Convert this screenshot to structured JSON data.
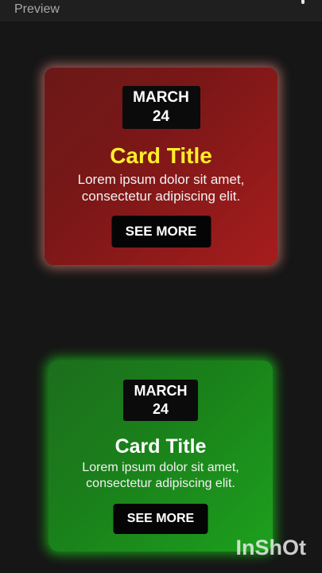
{
  "header": {
    "title": "Preview"
  },
  "cards": [
    {
      "date_month": "MARCH",
      "date_day": "24",
      "title": "Card Title",
      "text_line1": "Lorem ipsum dolor sit amet,",
      "text_line2": "consectetur adipiscing elit.",
      "button_label": "SEE MORE",
      "theme_color": "#8c1b1b",
      "title_color": "#ffee2a"
    },
    {
      "date_month": "MARCH",
      "date_day": "24",
      "title": "Card Title",
      "text_line1": "Lorem ipsum dolor sit amet,",
      "text_line2": "consectetur adipiscing elit.",
      "button_label": "SEE MORE",
      "theme_color": "#1a8a1a",
      "title_color": "#ffffff"
    }
  ],
  "watermark": {
    "text": "InShOt"
  }
}
